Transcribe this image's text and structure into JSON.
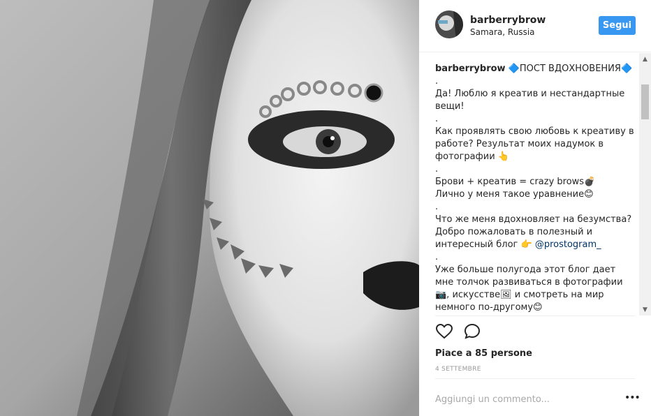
{
  "post": {
    "username": "barberrybrow",
    "location": "Samara, Russia",
    "follow_label": "Segui"
  },
  "caption": {
    "user": "barberrybrow",
    "text_lead": " 🔷ПОСТ ВДОХНОВЕНИЯ🔷\n.\nДа! Люблю я креатив и нестандартные вещи!\n.\nКак проявлять свою любовь к креативу в работе? Результат моих надумок в фотографии 👆\n.\nБрови + креатив = crazy brows💣\nЛично у меня такое уравнение😊\n.\nЧто же меня вдохновляет на безумства? Добро пожаловать в полезный и интересный блог 👉 ",
    "mention": "@prostogram_",
    "text_tail": "\n.\nУже больше полугода этот блог дает мне толчок развиваться в фотографии📷, искусстве🖼 и смотреть на мир немного по-другому😊"
  },
  "engagement": {
    "likes_text": "Piace a 85 persone",
    "date_text": "4 SETTEMBRE"
  },
  "comment": {
    "placeholder": "Aggiungi un commento...",
    "more_label": "•••"
  },
  "icons": {
    "like": "heart-icon",
    "comment": "comment-icon",
    "scroll_up": "scroll-up-arrow-icon",
    "scroll_down": "scroll-down-arrow-icon"
  },
  "colors": {
    "follow_button": "#3897f0",
    "text": "#262626",
    "muted": "#999999"
  }
}
